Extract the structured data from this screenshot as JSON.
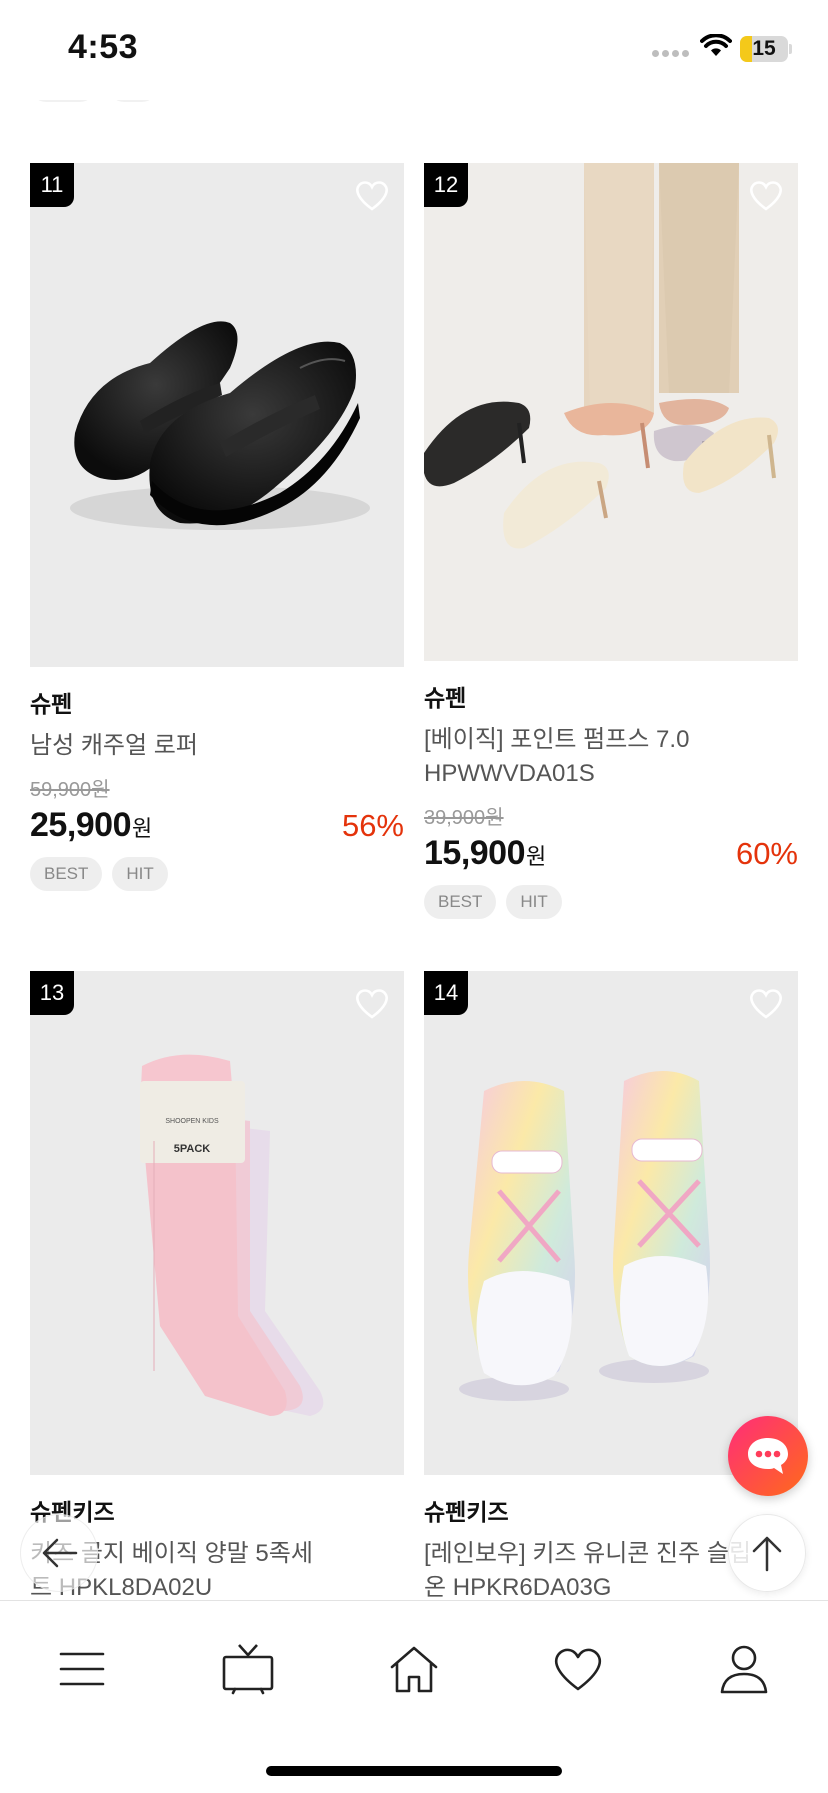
{
  "status_bar": {
    "time": "4:53",
    "battery": "15"
  },
  "products": [
    {
      "rank": "11",
      "brand": "슈펜",
      "name": "남성 캐주얼 로퍼",
      "original_price": "59,900원",
      "price": "25,900",
      "currency": "원",
      "discount": "56%",
      "tags": [
        "BEST",
        "HIT"
      ],
      "image": "black-penny-loafers"
    },
    {
      "rank": "12",
      "brand": "슈펜",
      "name": "[베이직] 포인트 펌프스 7.0 HPWWVDA01S",
      "original_price": "39,900원",
      "price": "15,900",
      "currency": "원",
      "discount": "60%",
      "tags": [
        "BEST",
        "HIT"
      ],
      "image": "pointed-pumps"
    },
    {
      "rank": "13",
      "brand": "슈펜키즈",
      "name": "키즈 골지 베이직 양말 5족세트 HPKL8DA02U",
      "image": "pink-socks-5pack",
      "package_label": "5PACK"
    },
    {
      "rank": "14",
      "brand": "슈펜키즈",
      "name": "[레인보우] 키즈 유니콘 진주 슬립온 HPKR6DA03G",
      "image": "rainbow-kids-sneakers"
    }
  ],
  "nav": [
    {
      "icon": "menu-icon"
    },
    {
      "icon": "tv-icon"
    },
    {
      "icon": "home-icon"
    },
    {
      "icon": "heart-icon"
    },
    {
      "icon": "user-icon"
    }
  ],
  "colors": {
    "discount": "#e4330b",
    "chat_start": "#ff2d7a",
    "chat_end": "#ff6a1a",
    "thumb_bg": "#ebebeb"
  }
}
